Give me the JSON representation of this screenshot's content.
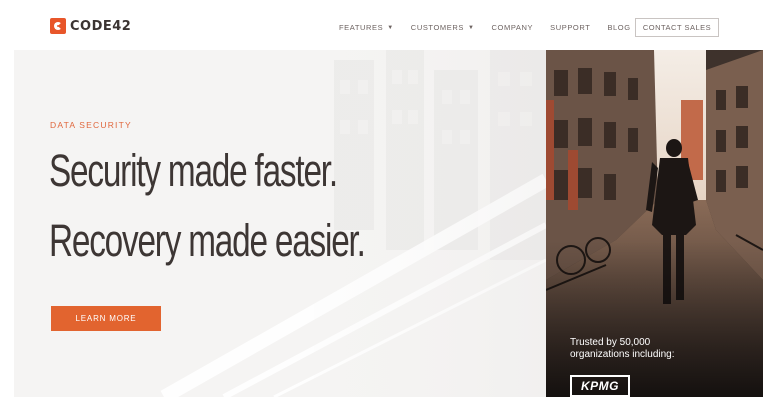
{
  "header": {
    "logo_text": "CODE42",
    "nav": [
      {
        "label": "FEATURES",
        "has_dropdown": true
      },
      {
        "label": "CUSTOMERS",
        "has_dropdown": true
      },
      {
        "label": "COMPANY",
        "has_dropdown": false
      },
      {
        "label": "SUPPORT",
        "has_dropdown": false
      },
      {
        "label": "BLOG",
        "has_dropdown": false
      }
    ],
    "contact_label": "CONTACT SALES"
  },
  "hero": {
    "eyebrow": "DATA SECURITY",
    "headline_1": "Security made faster.",
    "headline_2": "Recovery made easier.",
    "cta_label": "LEARN MORE"
  },
  "photo_panel": {
    "trusted_text": "Trusted by 50,000 organizations including:",
    "client_logo": "KPMG"
  },
  "colors": {
    "accent": "#e2642f",
    "heading": "#3d3634",
    "nav_text": "#6d6361"
  },
  "icons": {
    "logo": "code42-logo-icon",
    "dropdown": "chevron-down-icon"
  }
}
